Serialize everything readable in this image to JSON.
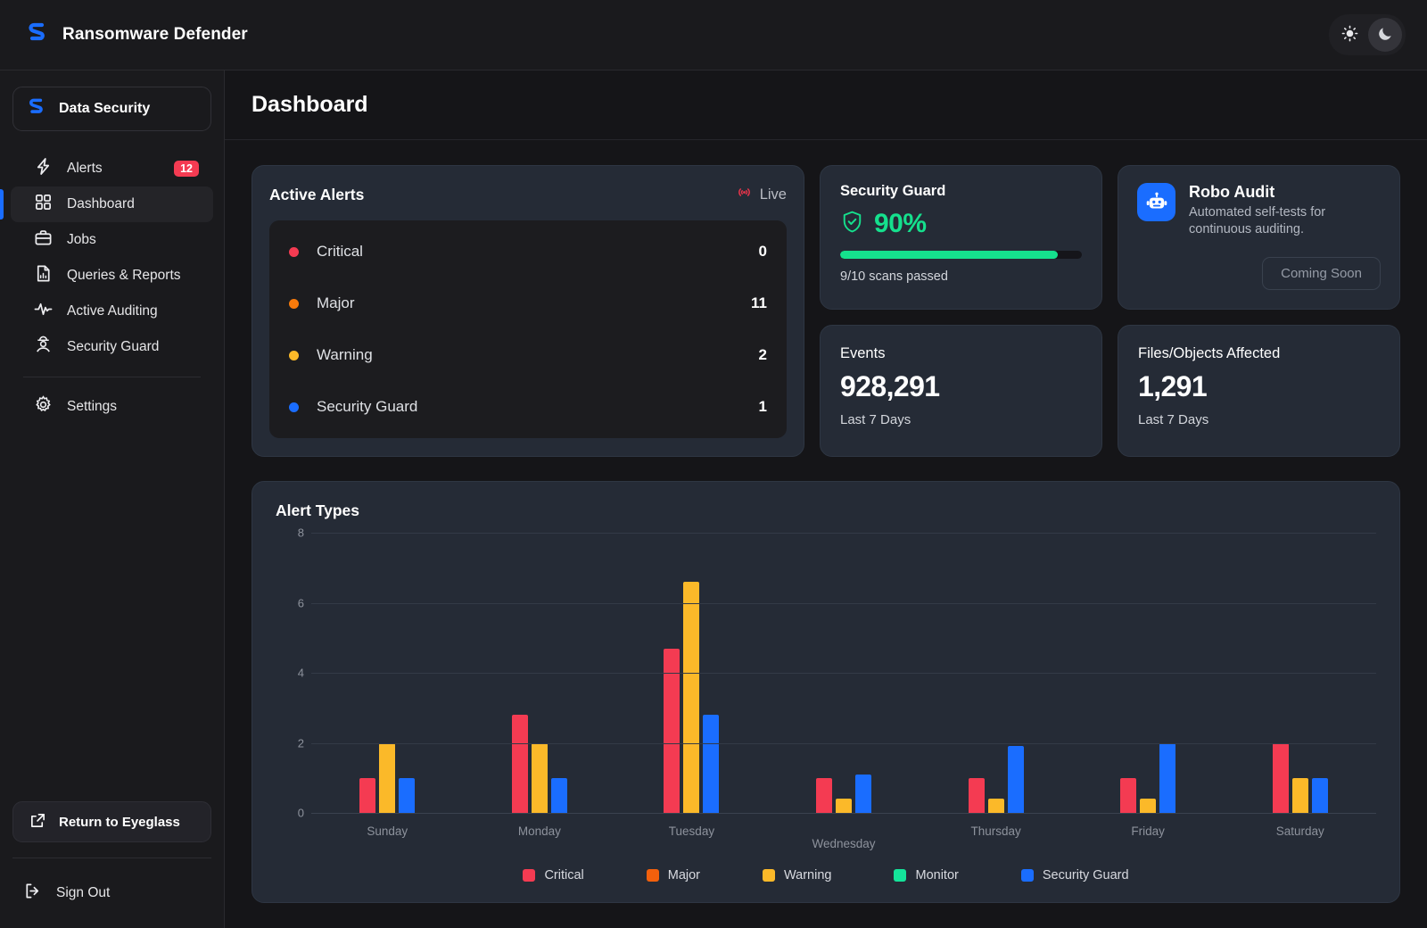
{
  "app": {
    "brand_name": "Ransomware Defender",
    "logo_icon": "shield-bolt-logo"
  },
  "theme_toggle": {
    "light_icon": "sun-icon",
    "dark_icon": "moon-icon",
    "active": "dark"
  },
  "sidebar": {
    "product": {
      "label": "Data Security",
      "icon": "brand-logo-icon"
    },
    "items": [
      {
        "label": "Alerts",
        "icon": "bolt-icon",
        "badge": "12",
        "active": false
      },
      {
        "label": "Dashboard",
        "icon": "grid-icon",
        "active": true
      },
      {
        "label": "Jobs",
        "icon": "briefcase-icon",
        "active": false
      },
      {
        "label": "Queries & Reports",
        "icon": "document-chart-icon",
        "active": false
      },
      {
        "label": "Active Auditing",
        "icon": "pulse-icon",
        "active": false
      },
      {
        "label": "Security Guard",
        "icon": "guard-icon",
        "active": false
      },
      {
        "label": "Settings",
        "icon": "gear-icon",
        "active": false
      }
    ],
    "return_button": {
      "label": "Return to Eyeglass",
      "icon": "external-link-icon"
    },
    "sign_out": {
      "label": "Sign Out",
      "icon": "logout-icon"
    }
  },
  "header": {
    "title": "Dashboard"
  },
  "active_alerts": {
    "title": "Active Alerts",
    "live_label": "Live",
    "live_icon": "broadcast-icon",
    "rows": [
      {
        "label": "Critical",
        "count": "0",
        "color": "#f43b52"
      },
      {
        "label": "Major",
        "count": "11",
        "color": "#f77a0b"
      },
      {
        "label": "Warning",
        "count": "2",
        "color": "#fbb929"
      },
      {
        "label": "Security Guard",
        "count": "1",
        "color": "#1a6dff"
      }
    ]
  },
  "security_guard": {
    "title": "Security Guard",
    "percent_label": "90%",
    "percent_value": 90,
    "shield_icon": "shield-check-icon",
    "subtitle": "9/10 scans passed",
    "accent_color": "#15e08d"
  },
  "robo_audit": {
    "title": "Robo Audit",
    "description": "Automated self-tests for continuous auditing.",
    "icon": "robot-icon",
    "button_label": "Coming Soon"
  },
  "stats": [
    {
      "title": "Events",
      "value": "928,291",
      "subtitle": "Last 7 Days"
    },
    {
      "title": "Files/Objects Affected",
      "value": "1,291",
      "subtitle": "Last 7 Days"
    }
  ],
  "chart_data": {
    "type": "bar",
    "title": "Alert Types",
    "xlabel": "",
    "ylabel": "",
    "ylim": [
      0,
      8
    ],
    "yticks": [
      0,
      2,
      4,
      6,
      8
    ],
    "grid": true,
    "legend_position": "bottom",
    "categories": [
      "Sunday",
      "Monday",
      "Tuesday",
      "Wednesday",
      "Thursday",
      "Friday",
      "Saturday"
    ],
    "series": [
      {
        "name": "Critical",
        "color": "#f43b52",
        "values": [
          1,
          2.8,
          4.7,
          1,
          1,
          1,
          2
        ]
      },
      {
        "name": "Major",
        "color": "#f2600c",
        "values": [
          0,
          0,
          0,
          0,
          0,
          0,
          0
        ]
      },
      {
        "name": "Warning",
        "color": "#fbb929",
        "values": [
          2,
          2,
          6.6,
          0.4,
          0.4,
          0.4,
          1
        ]
      },
      {
        "name": "Monitor",
        "color": "#14e49a",
        "values": [
          0,
          0,
          0,
          0,
          0,
          0,
          0
        ]
      },
      {
        "name": "Security Guard",
        "color": "#1a6dff",
        "values": [
          1,
          1,
          2.8,
          1.1,
          1.9,
          2,
          1
        ]
      }
    ]
  }
}
